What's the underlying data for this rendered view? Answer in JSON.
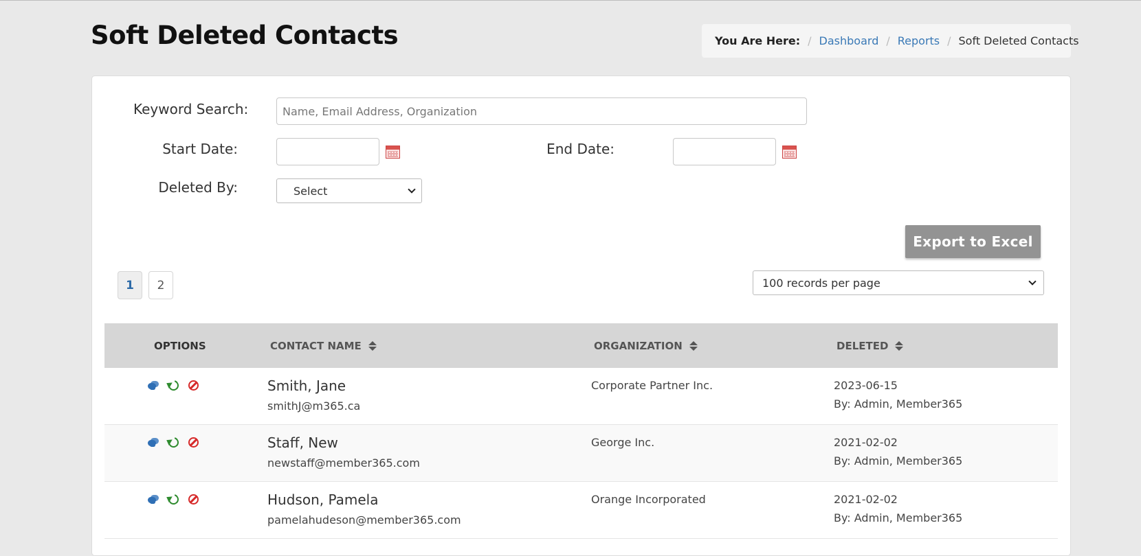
{
  "page": {
    "title": "Soft Deleted Contacts"
  },
  "breadcrumb": {
    "label": "You Are Here:",
    "items": [
      "Dashboard",
      "Reports"
    ],
    "current": "Soft Deleted Contacts"
  },
  "filters": {
    "keyword_label": "Keyword Search:",
    "keyword_value": "",
    "keyword_placeholder": "Name, Email Address, Organization",
    "start_label": "Start Date:",
    "start_value": "",
    "end_label": "End Date:",
    "end_value": "",
    "deleted_by_label": "Deleted By:",
    "deleted_by_value": "Select"
  },
  "actions": {
    "export_label": "Export to Excel"
  },
  "pagination": {
    "pages": [
      "1",
      "2"
    ],
    "active": "1"
  },
  "per_page": {
    "value": "100 records per page"
  },
  "table": {
    "headers": {
      "options": "OPTIONS",
      "contact_name": "CONTACT NAME",
      "organization": "ORGANIZATION",
      "deleted": "DELETED"
    },
    "row_icons": [
      "chat-icon",
      "restore-icon",
      "ban-icon"
    ],
    "rows": [
      {
        "name": "Smith, Jane",
        "email": "smithJ@m365.ca",
        "organization": "Corporate Partner Inc.",
        "date": "2023-06-15",
        "by": "By: Admin, Member365"
      },
      {
        "name": "Staff, New",
        "email": "newstaff@member365.com",
        "organization": "George Inc.",
        "date": "2021-02-02",
        "by": "By: Admin, Member365"
      },
      {
        "name": "Hudson, Pamela",
        "email": "pamelahudeson@member365.com",
        "organization": "Orange Incorporated",
        "date": "2021-02-02",
        "by": "By: Admin, Member365"
      }
    ]
  },
  "colors": {
    "link": "#3a79b6",
    "restore": "#2e8b2e",
    "delete": "#d62828",
    "chat": "#2f6fb5",
    "header_bg": "#d6d6d6"
  }
}
